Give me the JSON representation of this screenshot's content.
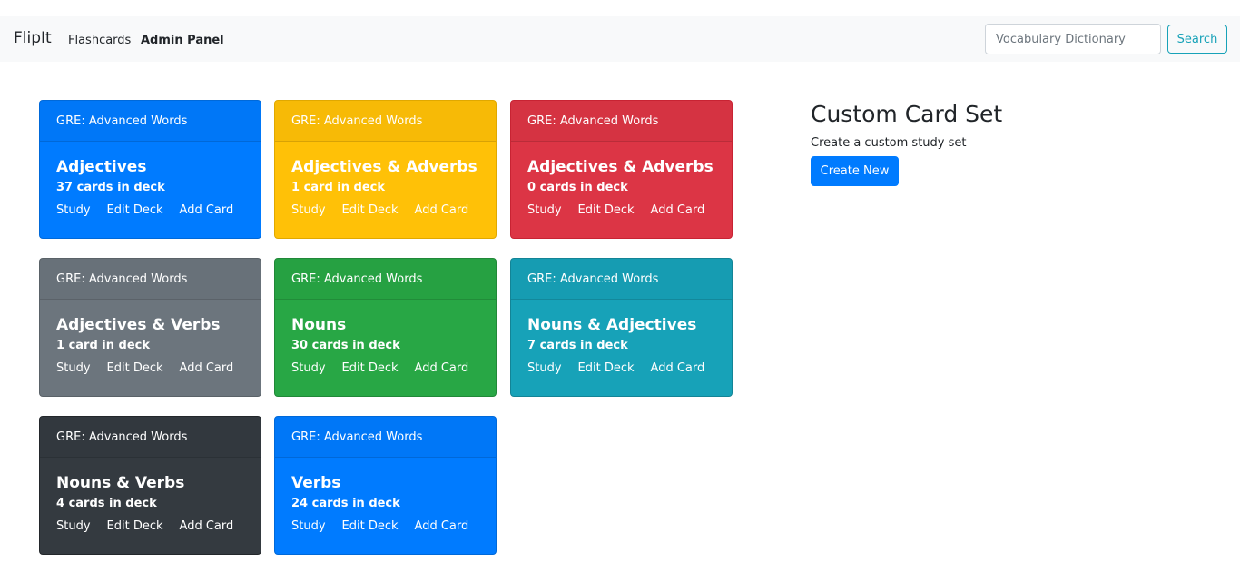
{
  "navbar": {
    "brand": "FlipIt",
    "links": [
      "Flashcards",
      "Admin Panel"
    ],
    "search_placeholder": "Vocabulary Dictionary",
    "search_button": "Search"
  },
  "decks": [
    {
      "header": "GRE: Advanced Words",
      "title": "Adjectives",
      "count": "37 cards in deck",
      "color": "#007bff",
      "actions": [
        "Study",
        "Edit Deck",
        "Add Card"
      ]
    },
    {
      "header": "GRE: Advanced Words",
      "title": "Adjectives & Adverbs",
      "count": "1 card in deck",
      "color": "#ffc107",
      "actions": [
        "Study",
        "Edit Deck",
        "Add Card"
      ]
    },
    {
      "header": "GRE: Advanced Words",
      "title": "Adjectives & Adverbs",
      "count": "0 cards in deck",
      "color": "#dc3545",
      "actions": [
        "Study",
        "Edit Deck",
        "Add Card"
      ]
    },
    {
      "header": "GRE: Advanced Words",
      "title": "Adjectives & Verbs",
      "count": "1 card in deck",
      "color": "#6c757d",
      "actions": [
        "Study",
        "Edit Deck",
        "Add Card"
      ]
    },
    {
      "header": "GRE: Advanced Words",
      "title": "Nouns",
      "count": "30 cards in deck",
      "color": "#28a745",
      "actions": [
        "Study",
        "Edit Deck",
        "Add Card"
      ]
    },
    {
      "header": "GRE: Advanced Words",
      "title": "Nouns & Adjectives",
      "count": "7 cards in deck",
      "color": "#17a2b8",
      "actions": [
        "Study",
        "Edit Deck",
        "Add Card"
      ]
    },
    {
      "header": "GRE: Advanced Words",
      "title": "Nouns & Verbs",
      "count": "4 cards in deck",
      "color": "#343a40",
      "actions": [
        "Study",
        "Edit Deck",
        "Add Card"
      ]
    },
    {
      "header": "GRE: Advanced Words",
      "title": "Verbs",
      "count": "24 cards in deck",
      "color": "#007bff",
      "actions": [
        "Study",
        "Edit Deck",
        "Add Card"
      ]
    }
  ],
  "custom_set": {
    "title": "Custom Card Set",
    "subtitle": "Create a custom study set",
    "button": "Create New"
  }
}
